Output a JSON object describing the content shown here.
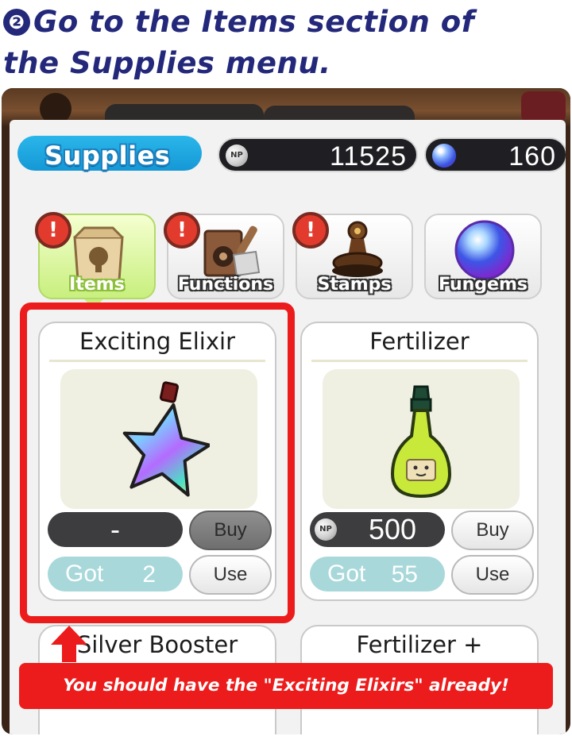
{
  "instruction": {
    "step_number": "❷",
    "line1": "Go to the Items section of",
    "line2": "the Supplies menu."
  },
  "header": {
    "title": "Supplies",
    "np_icon_label": "NP",
    "np_balance": "11525",
    "gem_balance": "160"
  },
  "tabs": [
    {
      "label": "Items",
      "active": true,
      "alert": "!"
    },
    {
      "label": "Functions",
      "active": false,
      "alert": "!"
    },
    {
      "label": "Stamps",
      "active": false,
      "alert": "!"
    },
    {
      "label": "Fungems",
      "active": false
    }
  ],
  "items": [
    {
      "name": "Exciting Elixir",
      "price": "-",
      "buy_label": "Buy",
      "got_label": "Got",
      "got_count": "2",
      "use_label": "Use",
      "buy_enabled": false
    },
    {
      "name": "Fertilizer",
      "price": "500",
      "price_icon": "NP",
      "buy_label": "Buy",
      "got_label": "Got",
      "got_count": "55",
      "use_label": "Use",
      "buy_enabled": true
    },
    {
      "name": "Silver Booster"
    },
    {
      "name": "Fertilizer +"
    }
  ],
  "callout": "You should have the \"Exciting Elixirs\" already!",
  "colors": {
    "heading": "#23287a",
    "highlight": "#ec1c1c",
    "supplies_blue": "#1598d6",
    "active_tab": "#c8ef7e",
    "got_pill": "#a8d8da"
  },
  "icons": [
    "alert-icon",
    "np-coin-icon",
    "gem-orb-icon",
    "paper-bag-icon",
    "speaker-shovel-icon",
    "stamp-icon",
    "crystal-ball-icon",
    "star-bottle-icon",
    "green-bottle-icon",
    "up-arrow-icon"
  ]
}
